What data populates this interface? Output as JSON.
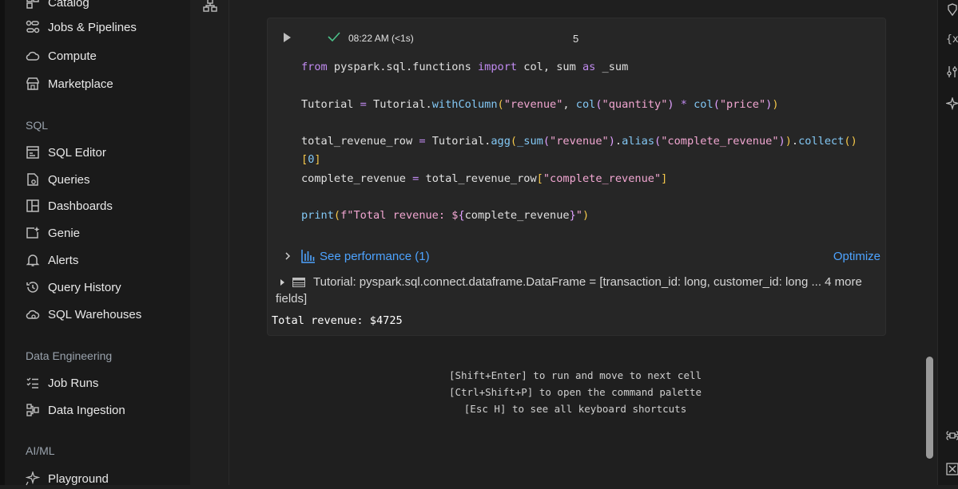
{
  "sidebar": {
    "items_top": [
      {
        "label": "Catalog",
        "icon": "catalog-icon"
      },
      {
        "label": "Jobs & Pipelines",
        "icon": "jobs-icon"
      },
      {
        "label": "Compute",
        "icon": "cloud-icon"
      },
      {
        "label": "Marketplace",
        "icon": "store-icon"
      }
    ],
    "sql_section": "SQL",
    "sql_items": [
      {
        "label": "SQL Editor",
        "icon": "sql-editor-icon"
      },
      {
        "label": "Queries",
        "icon": "queries-icon"
      },
      {
        "label": "Dashboards",
        "icon": "dashboards-icon"
      },
      {
        "label": "Genie",
        "icon": "genie-icon"
      },
      {
        "label": "Alerts",
        "icon": "bell-icon"
      },
      {
        "label": "Query History",
        "icon": "history-icon"
      },
      {
        "label": "SQL Warehouses",
        "icon": "warehouse-icon"
      }
    ],
    "de_section": "Data Engineering",
    "de_items": [
      {
        "label": "Job Runs",
        "icon": "job-runs-icon"
      },
      {
        "label": "Data Ingestion",
        "icon": "ingestion-icon"
      }
    ],
    "aiml_section": "AI/ML",
    "aiml_items": [
      {
        "label": "Playground",
        "icon": "playground-icon"
      }
    ]
  },
  "cell": {
    "run_time": "08:22 AM (<1s)",
    "cell_number": "5",
    "code": {
      "l1": {
        "kw1": "from",
        "mod": " pyspark.sql.functions ",
        "kw2": "import",
        "rest1": " col, sum ",
        "kw3": "as",
        "rest2": " _sum"
      },
      "l2": {
        "a": "Tutorial ",
        "eq": "=",
        "b": " Tutorial.",
        "fn": "withColumn",
        "p1": "(",
        "s1": "\"revenue\"",
        "c1": ", ",
        "fn2": "col",
        "p2": "(",
        "s2": "\"quantity\"",
        "p3": ")",
        "mul": " * ",
        "fn3": "col",
        "p4": "(",
        "s3": "\"price\"",
        "p5": ")",
        "p6": ")"
      },
      "l3": {
        "a": "total_revenue_row ",
        "eq": "=",
        "b": " Tutorial.",
        "fn": "agg",
        "p1": "(",
        "fn2": "_sum",
        "p2": "(",
        "s1": "\"revenue\"",
        "p3": ")",
        "dot": ".",
        "fn3": "alias",
        "p4": "(",
        "s2": "\"complete_revenue\"",
        "p5": ")",
        "p6": ")",
        "dot2": ".",
        "fn4": "collect",
        "p7": "()"
      },
      "l3b": {
        "b1": "[",
        "n": "0",
        "b2": "]"
      },
      "l4": {
        "a": "complete_revenue ",
        "eq": "=",
        "b": " total_revenue_row",
        "b1": "[",
        "s": "\"complete_revenue\"",
        "b2": "]"
      },
      "l5": {
        "fn": "print",
        "p1": "(",
        "s1": "f\"Total revenue: $",
        "b1": "{",
        "v": "complete_revenue",
        "b2": "}",
        "s2": "\"",
        "p2": ")"
      }
    },
    "performance_label": "See performance (1)",
    "optimize_label": "Optimize",
    "df_line": "Tutorial:  pyspark.sql.connect.dataframe.DataFrame = [transaction_id: long, customer_id: long ... 4 more fields]",
    "output": "Total revenue: $4725"
  },
  "hints": [
    "[Shift+Enter] to run and move to next cell",
    "[Ctrl+Shift+P] to open the command palette",
    "[Esc H] to see all keyboard shortcuts"
  ]
}
